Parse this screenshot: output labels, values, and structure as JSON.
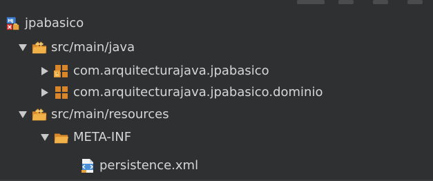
{
  "colors": {
    "background": "#2f3031",
    "text": "#d6d6d6",
    "folder": "#e8a23b",
    "package": "#d9862b",
    "xml_blue": "#4a90d9"
  },
  "tree": {
    "project": {
      "label": "jpabasico",
      "icon": "maven-project-icon"
    },
    "src_main_java": {
      "label": "src/main/java",
      "icon": "source-folder-icon",
      "expanded": true
    },
    "pkg_jpabasico": {
      "label": "com.arquitecturajava.jpabasico",
      "icon": "package-icon",
      "expanded": false
    },
    "pkg_dominio": {
      "label": "com.arquitecturajava.jpabasico.dominio",
      "icon": "package-icon",
      "expanded": false
    },
    "src_main_resources": {
      "label": "src/main/resources",
      "icon": "source-folder-icon",
      "expanded": true
    },
    "meta_inf": {
      "label": "META-INF",
      "icon": "folder-icon",
      "expanded": true
    },
    "persistence_xml": {
      "label": "persistence.xml",
      "icon": "xml-file-icon"
    }
  }
}
